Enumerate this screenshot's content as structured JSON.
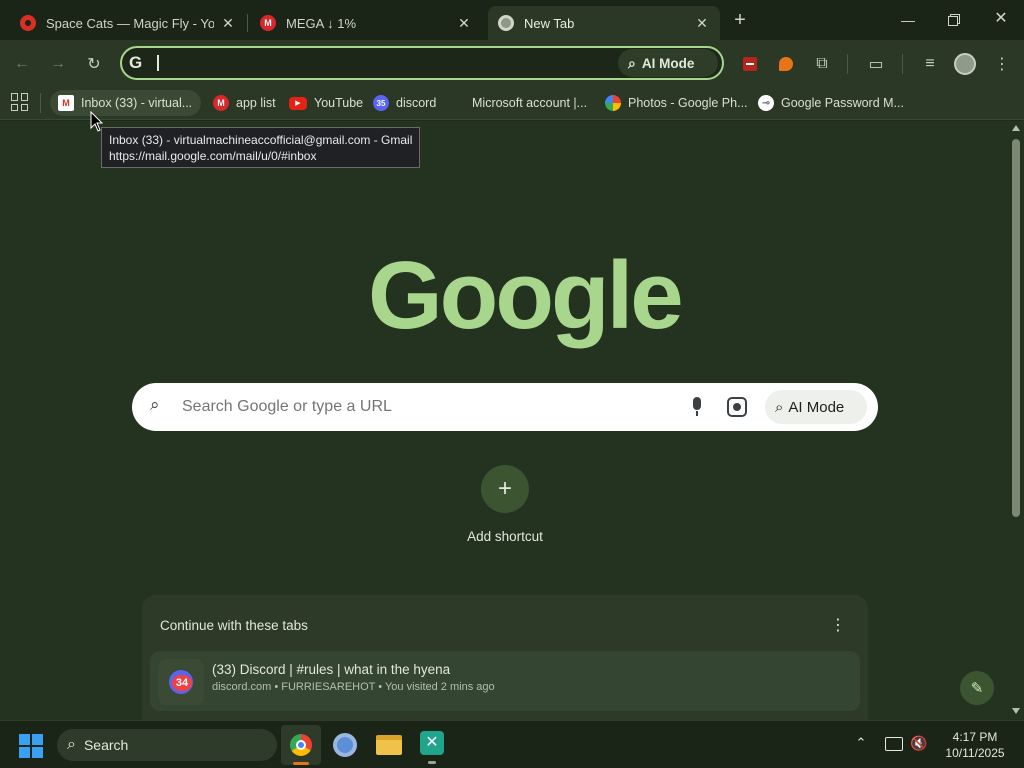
{
  "colors": {
    "accent": "#a7d68c",
    "background": "#243220",
    "card": "#2c3a27"
  },
  "tabs": [
    {
      "title": "Space Cats — Magic Fly - YouTube",
      "icon": "youtube-icon",
      "active": false
    },
    {
      "title": "MEGA ↓ 1%",
      "icon": "mega-icon",
      "active": false
    },
    {
      "title": "New Tab",
      "icon": "chrome-icon",
      "active": true
    }
  ],
  "new_tab_symbol": "+",
  "omnibox": {
    "value": "",
    "ai_mode_label": "AI Mode"
  },
  "bookmarks": [
    {
      "label": "Inbox (33) - virtual...",
      "icon": "gmail-icon"
    },
    {
      "label": "app list",
      "icon": "mega-icon"
    },
    {
      "label": "YouTube",
      "icon": "youtube-icon"
    },
    {
      "label": "discord",
      "icon": "discord-icon",
      "badge": "35"
    },
    {
      "label": "Microsoft account |...",
      "icon": "microsoft-icon"
    },
    {
      "label": "Photos - Google Ph...",
      "icon": "google-photos-icon"
    },
    {
      "label": "Google Password M...",
      "icon": "google-password-icon"
    }
  ],
  "tooltip": {
    "line1": "Inbox (33) - virtualmachineaccofficial@gmail.com - Gmail",
    "line2": "https://mail.google.com/mail/u/0/#inbox"
  },
  "main": {
    "logo_text": "Google",
    "search_placeholder": "Search Google or type a URL",
    "ai_mode_label": "AI Mode",
    "add_shortcut_label": "Add shortcut",
    "continue_card": {
      "title": "Continue with these tabs",
      "items": [
        {
          "title": "(33) Discord | #rules | what in the hyena",
          "subtitle": "discord.com • FURRIESAREHOT • You visited 2 mins ago",
          "badge": "34"
        }
      ]
    }
  },
  "taskbar": {
    "search_label": "Search",
    "time": "4:17 PM",
    "date": "10/11/2025"
  }
}
